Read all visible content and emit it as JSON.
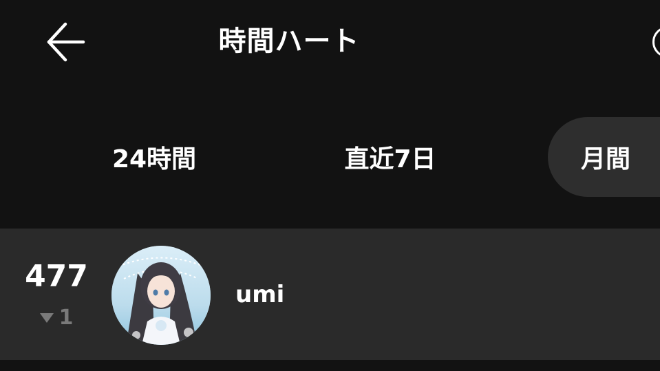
{
  "header": {
    "title": "時間ハート",
    "back_icon": "arrow-left-icon",
    "info_icon": "info-circle-icon"
  },
  "tabs": [
    {
      "label": "24時間",
      "selected": false
    },
    {
      "label": "直近7日",
      "selected": false
    },
    {
      "label": "月間",
      "selected": true
    }
  ],
  "ranking": [
    {
      "rank": "477",
      "change": "1",
      "change_direction": "down",
      "username": "umi"
    }
  ],
  "colors": {
    "background": "#121212",
    "row_background": "#2a2a2a",
    "selected_tab": "#2e2e2e",
    "muted_text": "#7a7a7a"
  }
}
